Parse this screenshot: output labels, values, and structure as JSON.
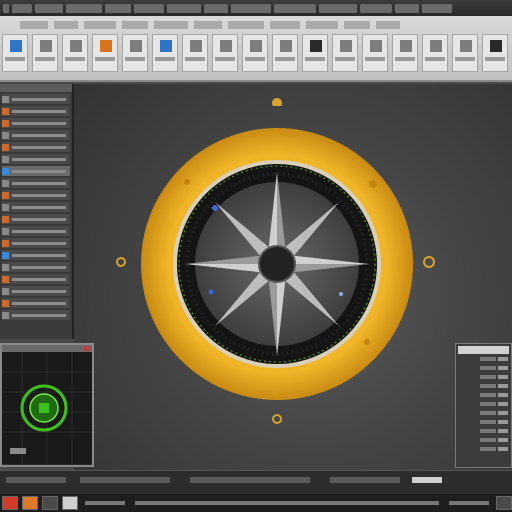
{
  "menu_items": [
    "",
    "",
    "",
    "",
    "",
    "",
    "",
    "",
    "",
    "",
    "",
    "",
    "",
    ""
  ],
  "ribbon_tabs": [
    "",
    "",
    "",
    "",
    "",
    "",
    "",
    "",
    "",
    "",
    ""
  ],
  "ribbon_buttons": [
    {
      "icon": "layout-icon",
      "tone": "blue"
    },
    {
      "icon": "document-icon",
      "tone": ""
    },
    {
      "icon": "text-icon",
      "tone": ""
    },
    {
      "icon": "table-icon",
      "tone": "orange"
    },
    {
      "icon": "grid-icon",
      "tone": ""
    },
    {
      "icon": "image-icon",
      "tone": "blue"
    },
    {
      "icon": "paste-icon",
      "tone": ""
    },
    {
      "icon": "shape-icon",
      "tone": ""
    },
    {
      "icon": "frame-icon",
      "tone": ""
    },
    {
      "icon": "chart-icon",
      "tone": ""
    },
    {
      "icon": "print-icon",
      "tone": "dark"
    },
    {
      "icon": "view-icon",
      "tone": ""
    },
    {
      "icon": "page-icon",
      "tone": ""
    },
    {
      "icon": "layer-icon",
      "tone": ""
    },
    {
      "icon": "window-icon",
      "tone": ""
    },
    {
      "icon": "settings-icon",
      "tone": ""
    },
    {
      "icon": "save-icon",
      "tone": "dark"
    }
  ],
  "compass": {
    "ring_color": "#e5a21c",
    "bezel_color": "#151515",
    "center_label": "",
    "labels": {
      "north": "",
      "east": "",
      "south": "",
      "west": ""
    }
  },
  "colors": {
    "accent_orange": "#e5a21c",
    "panel_dark": "#3a3a3a",
    "ribbon_light": "#d9d9d9",
    "minimap_green": "#3ec21a"
  }
}
